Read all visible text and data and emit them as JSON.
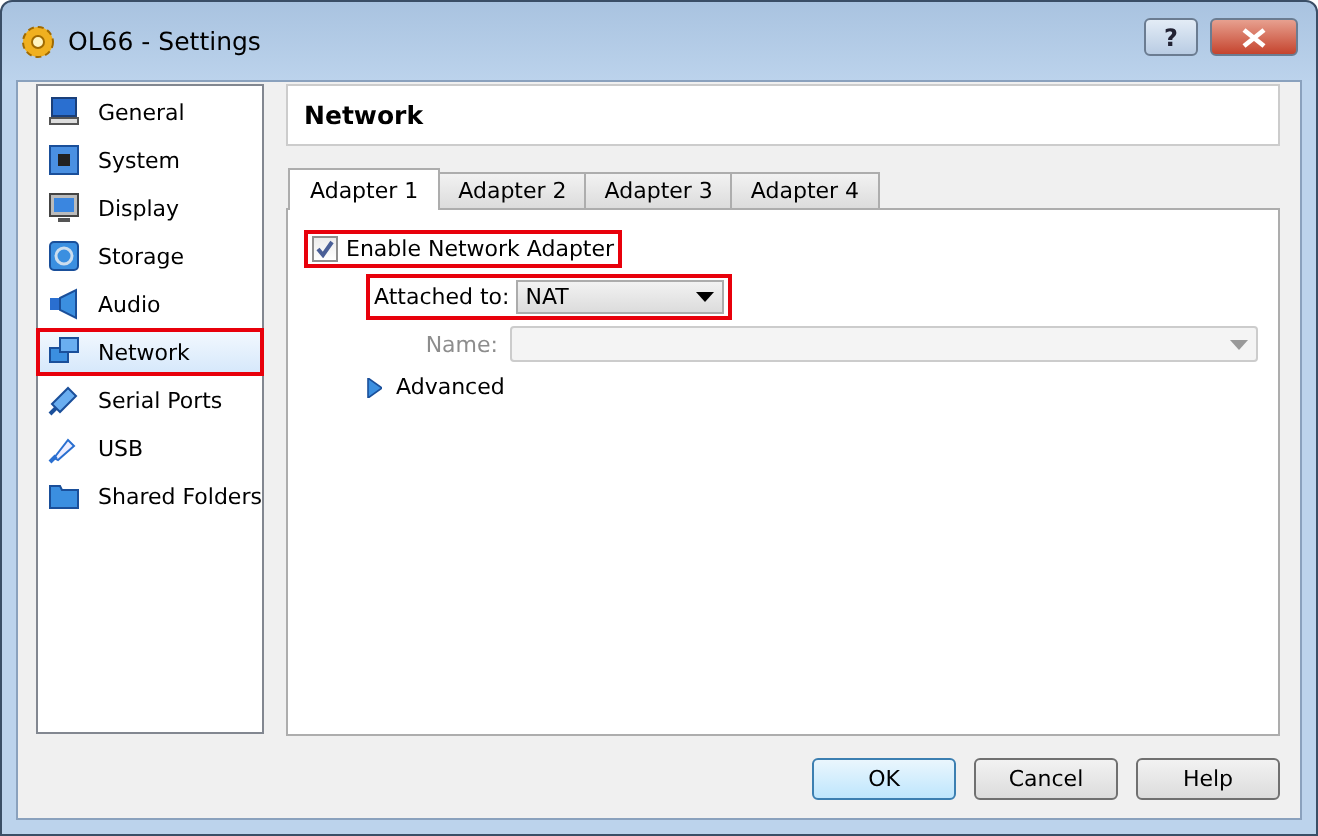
{
  "window": {
    "title": "OL66 - Settings",
    "help_button": "?"
  },
  "sidebar": {
    "items": [
      {
        "label": "General",
        "selected": false,
        "highlighted": false
      },
      {
        "label": "System",
        "selected": false,
        "highlighted": false
      },
      {
        "label": "Display",
        "selected": false,
        "highlighted": false
      },
      {
        "label": "Storage",
        "selected": false,
        "highlighted": false
      },
      {
        "label": "Audio",
        "selected": false,
        "highlighted": false
      },
      {
        "label": "Network",
        "selected": true,
        "highlighted": true
      },
      {
        "label": "Serial Ports",
        "selected": false,
        "highlighted": false
      },
      {
        "label": "USB",
        "selected": false,
        "highlighted": false
      },
      {
        "label": "Shared Folders",
        "selected": false,
        "highlighted": false
      }
    ]
  },
  "page": {
    "title": "Network",
    "tabs": [
      {
        "label": "Adapter 1",
        "selected": true
      },
      {
        "label": "Adapter 2",
        "selected": false
      },
      {
        "label": "Adapter 3",
        "selected": false
      },
      {
        "label": "Adapter 4",
        "selected": false
      }
    ],
    "enable_adapter": {
      "label": "Enable Network Adapter",
      "checked": true,
      "highlighted": true
    },
    "attached_to": {
      "label": "Attached to:",
      "value": "NAT",
      "highlighted": true
    },
    "name": {
      "label": "Name:",
      "disabled": true
    },
    "advanced": {
      "label": "Advanced",
      "expanded": false
    }
  },
  "buttons": [
    {
      "label": "OK",
      "default": true
    },
    {
      "label": "Cancel",
      "default": false
    },
    {
      "label": "Help",
      "default": false
    }
  ]
}
